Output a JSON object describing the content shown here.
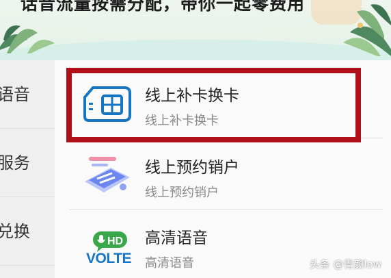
{
  "banner": {
    "text": "话音流量按需分配，带你一起零费用"
  },
  "sidebar": {
    "items": [
      {
        "label": "语音"
      },
      {
        "label": "服务"
      },
      {
        "label": "兑换"
      }
    ]
  },
  "list": [
    {
      "title": "线上补卡换卡",
      "subtitle": "线上补卡换卡",
      "icon": "sim-card-icon"
    },
    {
      "title": "线上预约销户",
      "subtitle": "线上预约销户",
      "icon": "phone-cancel-icon"
    },
    {
      "title": "高清语音",
      "subtitle": "高清语音",
      "icon": "volte-hd-icon",
      "icon_hd_label": "HD",
      "icon_volte_label": "VOLTE"
    }
  ],
  "colors": {
    "highlight": "#b0101a",
    "icon_blue": "#1776c4",
    "icon_green": "#3aa84a"
  },
  "watermark": "头条 @青颜low"
}
